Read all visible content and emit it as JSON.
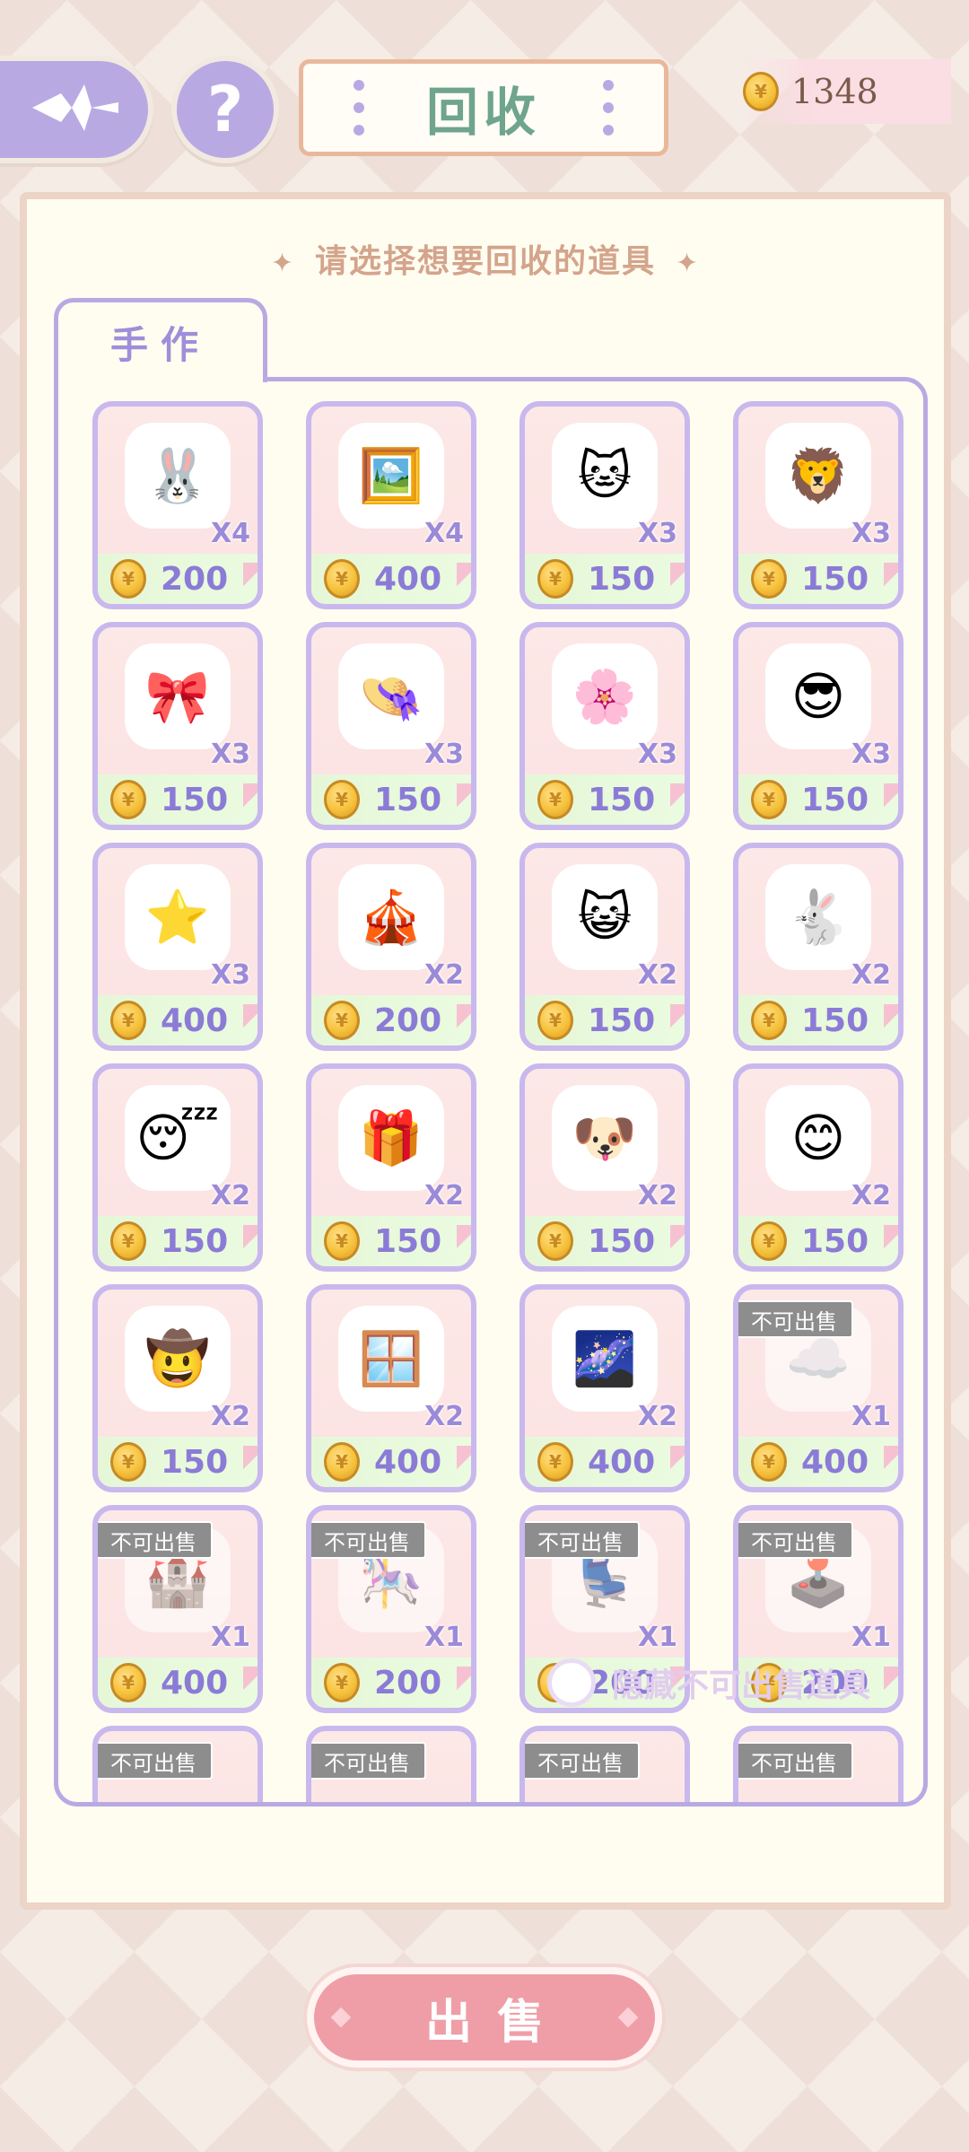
{
  "header": {
    "back_icon": "sparkle-arrow-left-icon",
    "help_label": "?",
    "title": "回收",
    "coin_amount": "1348"
  },
  "panel": {
    "prompt": "请选择想要回收的道具",
    "tab_label": "手作"
  },
  "items": [
    {
      "emoji": "🐰",
      "qty": "X4",
      "price": "200",
      "sellable": true
    },
    {
      "emoji": "🖼️",
      "qty": "X4",
      "price": "400",
      "sellable": true
    },
    {
      "emoji": "🐱",
      "qty": "X3",
      "price": "150",
      "sellable": true
    },
    {
      "emoji": "🦁",
      "qty": "X3",
      "price": "150",
      "sellable": true
    },
    {
      "emoji": "🎀",
      "qty": "X3",
      "price": "150",
      "sellable": true
    },
    {
      "emoji": "👒",
      "qty": "X3",
      "price": "150",
      "sellable": true
    },
    {
      "emoji": "🌸",
      "qty": "X3",
      "price": "150",
      "sellable": true
    },
    {
      "emoji": "😎",
      "qty": "X3",
      "price": "150",
      "sellable": true
    },
    {
      "emoji": "⭐",
      "qty": "X3",
      "price": "400",
      "sellable": true
    },
    {
      "emoji": "🎪",
      "qty": "X2",
      "price": "200",
      "sellable": true
    },
    {
      "emoji": "😺",
      "qty": "X2",
      "price": "150",
      "sellable": true
    },
    {
      "emoji": "🐇",
      "qty": "X2",
      "price": "150",
      "sellable": true
    },
    {
      "emoji": "😴",
      "qty": "X2",
      "price": "150",
      "sellable": true
    },
    {
      "emoji": "🎁",
      "qty": "X2",
      "price": "150",
      "sellable": true
    },
    {
      "emoji": "🐶",
      "qty": "X2",
      "price": "150",
      "sellable": true
    },
    {
      "emoji": "😊",
      "qty": "X2",
      "price": "150",
      "sellable": true
    },
    {
      "emoji": "🤠",
      "qty": "X2",
      "price": "150",
      "sellable": true
    },
    {
      "emoji": "🪟",
      "qty": "X2",
      "price": "400",
      "sellable": true
    },
    {
      "emoji": "🌌",
      "qty": "X2",
      "price": "400",
      "sellable": true
    },
    {
      "emoji": "☁️",
      "qty": "X1",
      "price": "400",
      "sellable": false
    },
    {
      "emoji": "🏰",
      "qty": "X1",
      "price": "400",
      "sellable": false
    },
    {
      "emoji": "🎠",
      "qty": "X1",
      "price": "200",
      "sellable": false
    },
    {
      "emoji": "💺",
      "qty": "X1",
      "price": "200",
      "sellable": false
    },
    {
      "emoji": "🕹️",
      "qty": "X1",
      "price": "200",
      "sellable": false
    },
    {
      "emoji": "",
      "qty": "",
      "price": "",
      "sellable": false
    },
    {
      "emoji": "",
      "qty": "",
      "price": "",
      "sellable": false
    },
    {
      "emoji": "",
      "qty": "",
      "price": "",
      "sellable": false
    },
    {
      "emoji": "",
      "qty": "",
      "price": "",
      "sellable": false
    }
  ],
  "not_for_sale_label": "不可出售",
  "hide_toggle_label": "隐藏不可出售道具",
  "sell_button_label": "出售",
  "colors": {
    "accent_purple": "#b9a9e3",
    "title_green": "#6fa48f",
    "sell_pink": "#ef9ea8",
    "price_purple": "#8b7bd6"
  }
}
